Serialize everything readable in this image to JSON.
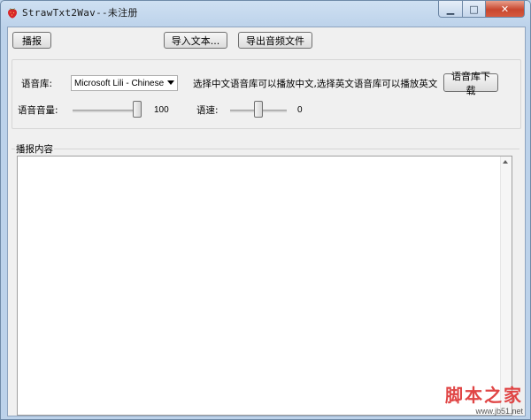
{
  "window": {
    "title": "StrawTxt2Wav--未注册",
    "minimize_symbol": "▁",
    "maximize_symbol": "□",
    "close_symbol": "✕"
  },
  "toolbar": {
    "play_label": "播报",
    "import_label": "导入文本...",
    "export_label": "导出音频文件"
  },
  "voice": {
    "library_label": "语音库:",
    "library_selected": "Microsoft Lili - Chinese (China)",
    "hint_text": "选择中文语音库可以播放中文,选择英文语音库可以播放英文",
    "download_label": "语音库下载",
    "volume_label": "语音音量:",
    "volume_value": "100",
    "volume_level": 1.0,
    "rate_label": "语速:",
    "rate_value": "0",
    "rate_level": 0.5
  },
  "content": {
    "group_label": "播报内容",
    "text": ""
  },
  "watermark": {
    "text": "脚本之家",
    "url": "www.jb51.net"
  },
  "colors": {
    "close_button": "#c8472f",
    "watermark": "#e04545",
    "frame": "#bcd2ea"
  }
}
